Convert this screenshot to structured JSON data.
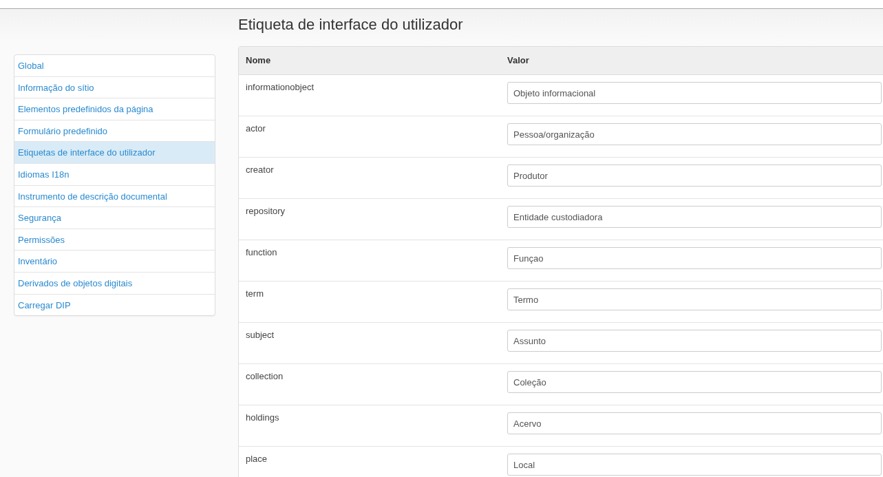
{
  "title": "Etiqueta de interface do utilizador",
  "sidebar": {
    "items": [
      {
        "label": "Global",
        "selected": false
      },
      {
        "label": "Informação do sítio",
        "selected": false
      },
      {
        "label": "Elementos predefinidos da página",
        "selected": false
      },
      {
        "label": "Formulário predefinido",
        "selected": false
      },
      {
        "label": "Etiquetas de interface do utilizador",
        "selected": true
      },
      {
        "label": "Idiomas I18n",
        "selected": false
      },
      {
        "label": "Instrumento de descrição documental",
        "selected": false
      },
      {
        "label": "Segurança",
        "selected": false
      },
      {
        "label": "Permissões",
        "selected": false
      },
      {
        "label": "Inventário",
        "selected": false
      },
      {
        "label": "Derivados de objetos digitais",
        "selected": false
      },
      {
        "label": "Carregar DIP",
        "selected": false
      }
    ]
  },
  "table": {
    "columns": [
      "Nome",
      "Valor"
    ],
    "rows": [
      {
        "name": "informationobject",
        "value": "Objeto informacional"
      },
      {
        "name": "actor",
        "value": "Pessoa/organização"
      },
      {
        "name": "creator",
        "value": "Produtor"
      },
      {
        "name": "repository",
        "value": "Entidade custodiadora"
      },
      {
        "name": "function",
        "value": "Funçao"
      },
      {
        "name": "term",
        "value": "Termo"
      },
      {
        "name": "subject",
        "value": "Assunto"
      },
      {
        "name": "collection",
        "value": "Coleção"
      },
      {
        "name": "holdings",
        "value": "Acervo"
      },
      {
        "name": "place",
        "value": "Local"
      }
    ]
  }
}
